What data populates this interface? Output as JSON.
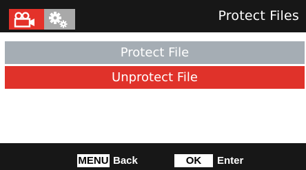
{
  "header": {
    "title": "Protect Files",
    "tabs": [
      {
        "icon": "video-camera-icon",
        "active": true
      },
      {
        "icon": "gears-icon",
        "active": false
      }
    ]
  },
  "menu": {
    "items": [
      {
        "label": "Protect File",
        "state": "normal"
      },
      {
        "label": "Unprotect File",
        "state": "selected"
      }
    ]
  },
  "footer": {
    "menu_key": "MENU",
    "menu_action": "Back",
    "ok_key": "OK",
    "ok_action": "Enter"
  },
  "colors": {
    "header_bg": "#171717",
    "accent_red": "#e0322a",
    "item_gray": "#a5adb4",
    "tab_gray": "#a9a9a9"
  }
}
